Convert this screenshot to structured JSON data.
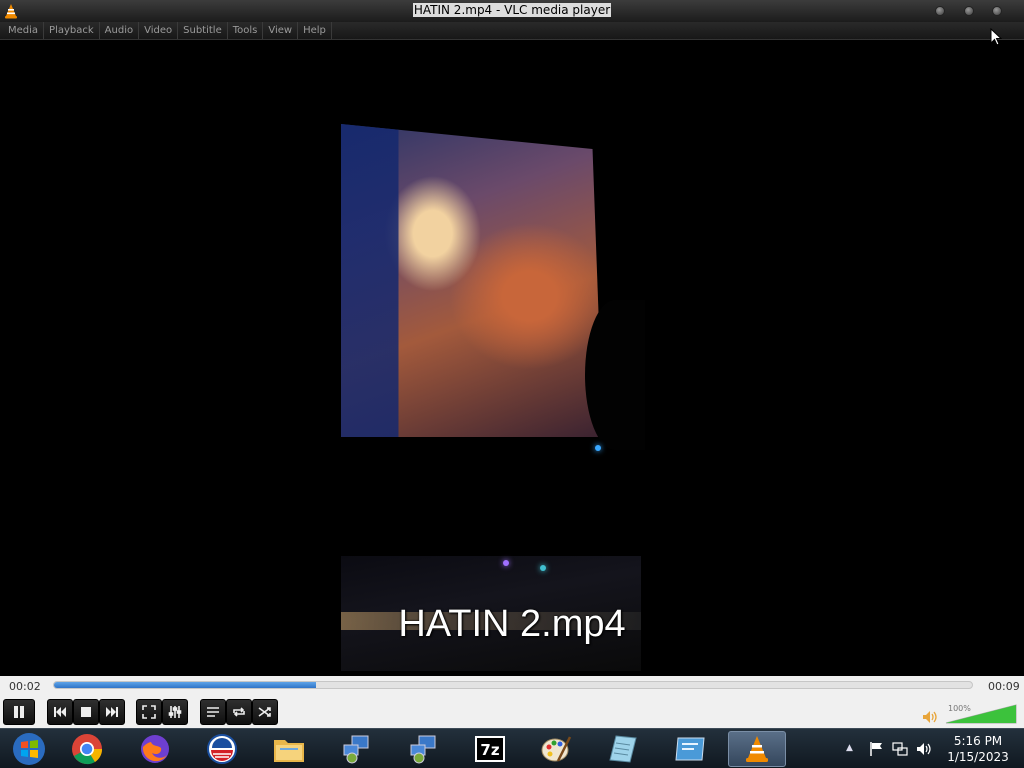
{
  "window": {
    "title": "HATIN 2.mp4 - VLC media player",
    "app_icon": "vlc-cone-icon",
    "buttons": [
      "minimize-icon",
      "maximize-icon",
      "close-icon"
    ]
  },
  "menu": [
    "Media",
    "Playback",
    "Audio",
    "Video",
    "Subtitle",
    "Tools",
    "View",
    "Help"
  ],
  "video": {
    "overlay_title": "HATIN 2.mp4"
  },
  "player": {
    "elapsed": "00:02",
    "total": "00:09",
    "progress_fraction": 0.285,
    "volume_label": "100%",
    "volume_fraction": 1.0,
    "controls": [
      "pause-icon",
      "previous-icon",
      "stop-icon",
      "next-icon",
      "fullscreen-icon",
      "extended-settings-icon",
      "playlist-icon",
      "loop-icon",
      "shuffle-icon",
      "speaker-icon"
    ]
  },
  "taskbar": {
    "apps": [
      "windows-start-icon",
      "chrome-icon",
      "firefox-icon",
      "obama-logo-icon",
      "file-explorer-icon",
      "network-app-icon",
      "network-app-2-icon",
      "7zip-icon",
      "paint-icon",
      "notepad-icon",
      "window-app-icon",
      "vlc-icon"
    ],
    "active_app": "vlc-icon",
    "clock_time": "5:16 PM",
    "clock_date": "1/15/2023",
    "tray_icons": [
      "show-hidden-icons-arrow",
      "action-center-flag-icon",
      "network-icon",
      "volume-icon"
    ]
  },
  "colors": {
    "seek_fill": "#2f74c8",
    "volume_fill": "#3cc23c",
    "taskbar": "#1a2430"
  }
}
